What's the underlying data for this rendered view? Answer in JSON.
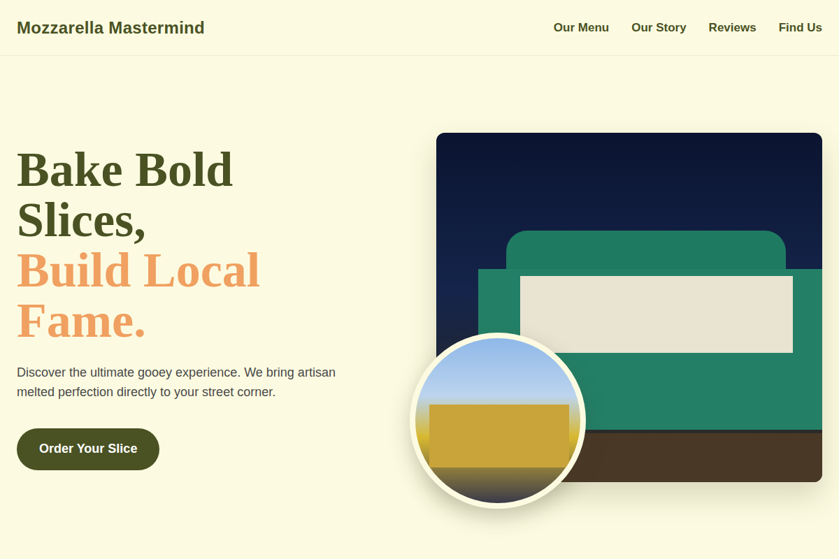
{
  "header": {
    "logo": "Mozzarella Mastermind",
    "nav": [
      {
        "label": "Our Menu"
      },
      {
        "label": "Our Story"
      },
      {
        "label": "Reviews"
      },
      {
        "label": "Find Us"
      }
    ]
  },
  "hero": {
    "headline": "Bake Bold Slices,",
    "highlight": "Build Local Fame.",
    "description": "Discover the ultimate gooey experience. We bring artisan melted perfection directly to your street corner.",
    "button": "Order Your Slice"
  }
}
